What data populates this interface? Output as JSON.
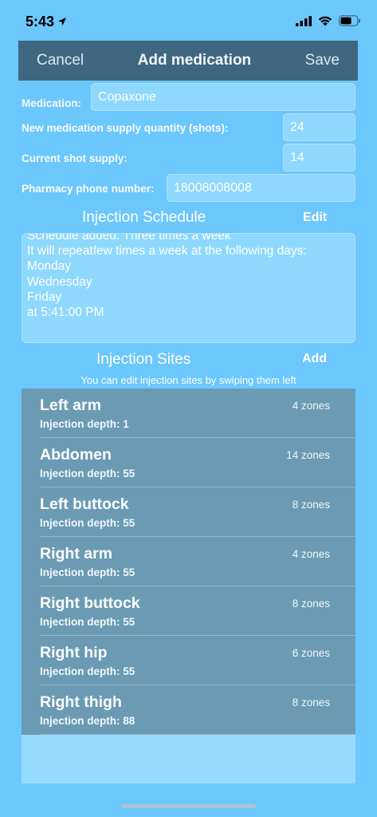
{
  "status": {
    "time": "5:43"
  },
  "nav": {
    "cancel": "Cancel",
    "title": "Add medication",
    "save": "Save"
  },
  "form": {
    "medication_label": "Medication:",
    "medication_value": "Copaxone",
    "supply_label": "New medication supply quantity (shots):",
    "supply_value": "24",
    "current_label": "Current shot supply:",
    "current_value": "14",
    "pharmacy_label": "Pharmacy phone number:",
    "pharmacy_value": "18008008008"
  },
  "schedule": {
    "title": "Injection Schedule",
    "edit": "Edit",
    "lines": [
      "Schedule added: Three times a week",
      "It will repeatfew times a week at the following days:",
      "Monday",
      "Wednesday",
      "Friday",
      "at 5:41:00 PM"
    ]
  },
  "sites": {
    "title": "Injection Sites",
    "add": "Add",
    "hint": "You can edit injection sites by swiping them left",
    "items": [
      {
        "name": "Left arm",
        "depth": "Injection depth: 1",
        "zones": "4 zones"
      },
      {
        "name": "Abdomen",
        "depth": "Injection depth: 55",
        "zones": "14 zones"
      },
      {
        "name": "Left buttock",
        "depth": "Injection depth: 55",
        "zones": "8 zones"
      },
      {
        "name": "Right arm",
        "depth": "Injection depth: 55",
        "zones": "4 zones"
      },
      {
        "name": "Right buttock",
        "depth": "Injection depth: 55",
        "zones": "8 zones"
      },
      {
        "name": "Right hip",
        "depth": "Injection depth: 55",
        "zones": "6 zones"
      },
      {
        "name": "Right thigh",
        "depth": "Injection depth: 88",
        "zones": "8 zones"
      }
    ]
  },
  "icons": [
    "location-arrow-icon",
    "cellular-signal-icon",
    "wifi-icon",
    "battery-icon"
  ],
  "colors": {
    "background": "#6cc7fc",
    "nav_bar": "#3f6880",
    "list_row": "#6a9bb3",
    "field": "#8ed8fe"
  }
}
